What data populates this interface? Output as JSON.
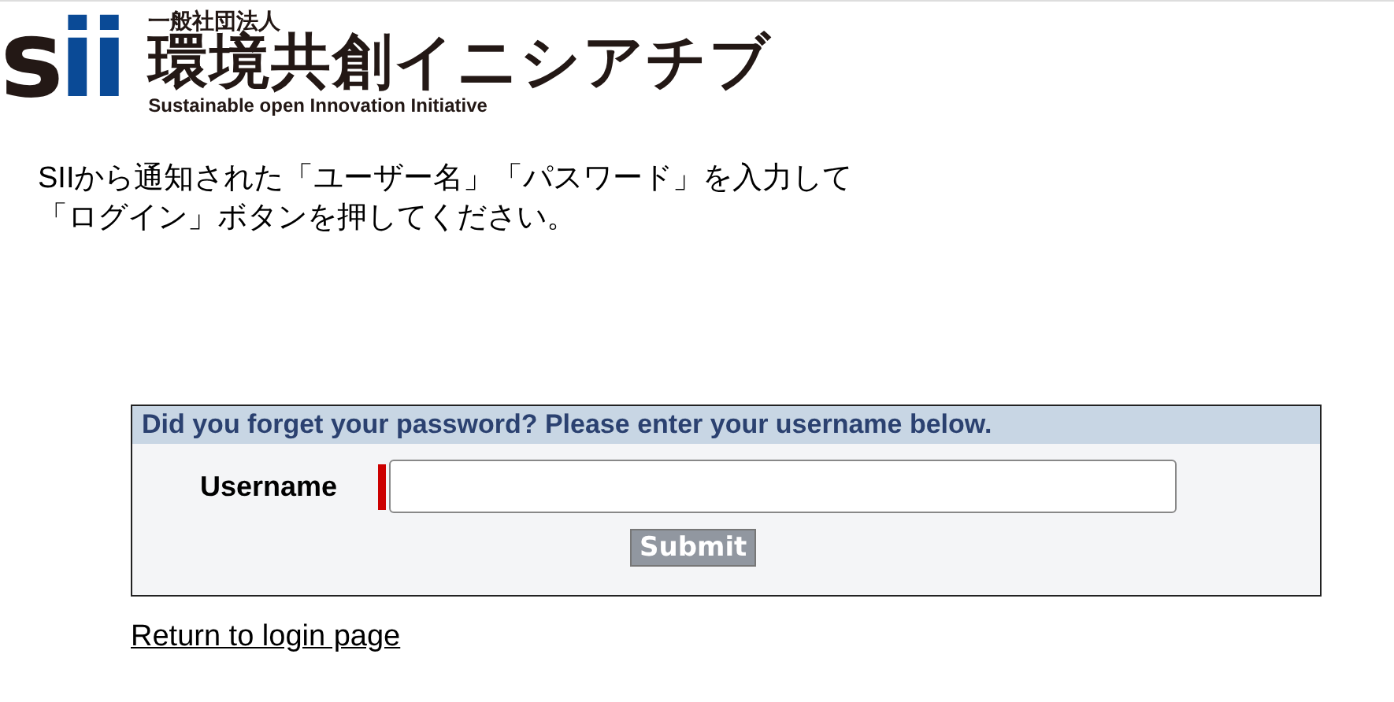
{
  "logo": {
    "mark": "sii",
    "org_type": "一般社団法人",
    "name": "環境共創イニシアチブ",
    "tagline": "Sustainable open Innovation Initiative"
  },
  "instructions": [
    "SIIから通知された「ユーザー名」「パスワード」を入力して",
    "「ログイン」ボタンを押してください。"
  ],
  "form": {
    "header": "Did you forget your password? Please enter your username below.",
    "field": {
      "label": "Username",
      "required": true
    },
    "submit": "Submit"
  },
  "link": "Return to login page"
}
